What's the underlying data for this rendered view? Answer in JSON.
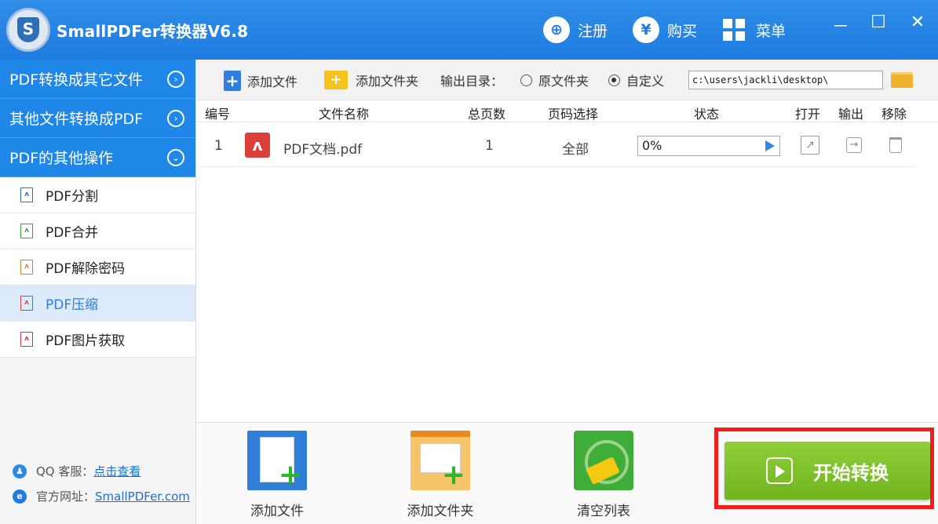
{
  "window": {
    "title": "SmallPDFer转换器V6.8",
    "logo_letter": "S",
    "actions": [
      {
        "label": "注册",
        "icon": "user-add-icon"
      },
      {
        "label": "购买",
        "icon": "yen-icon"
      },
      {
        "label": "菜单",
        "icon": "grid-menu-icon"
      }
    ],
    "controls": {
      "minimize": "－",
      "maximize": "☐",
      "close": "✕"
    }
  },
  "sidebar": {
    "categories": [
      {
        "label": "PDF转换成其它文件",
        "chevron": "›"
      },
      {
        "label": "其他文件转换成PDF",
        "chevron": "›"
      },
      {
        "label": "PDF的其他操作",
        "chevron": "⌄"
      }
    ],
    "items": [
      {
        "label": "PDF分割",
        "color": "#2e6fb8"
      },
      {
        "label": "PDF合并",
        "color": "#34a046"
      },
      {
        "label": "PDF解除密码",
        "color": "#c9862a"
      },
      {
        "label": "PDF压缩",
        "color": "#d9403a",
        "active": true
      },
      {
        "label": "PDF图片获取",
        "color": "#c43a3a"
      }
    ],
    "footer": {
      "qq_label": "QQ 客服：",
      "qq_link": "点击查看",
      "site_label": "官方网址：",
      "site_link": "SmallPDFer.com"
    }
  },
  "toolbar": {
    "add_file": "添加文件",
    "add_folder": "添加文件夹",
    "output_dir_label": "输出目录：",
    "option_original": "原文件夹",
    "option_custom": "自定义",
    "selected_option": "custom",
    "output_path": "c:\\users\\jackli\\desktop\\"
  },
  "table": {
    "headers": [
      "编号",
      "文件名称",
      "总页数",
      "页码选择",
      "状态",
      "打开",
      "输出",
      "移除"
    ],
    "rows": [
      {
        "index": "1",
        "filename": "PDF文档.pdf",
        "pages": "1",
        "page_select": "全部",
        "status": "0%"
      }
    ]
  },
  "bottom": {
    "add_file": "添加文件",
    "add_folder": "添加文件夹",
    "clear_list": "清空列表",
    "start": "开始转换"
  },
  "colors": {
    "titlebar": "#1e7be0",
    "sidebar_category": "#1f87e7",
    "start_button": "#7cc12a",
    "highlight": "#f21d1d"
  }
}
